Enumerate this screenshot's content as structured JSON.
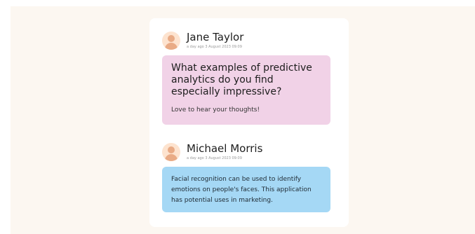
{
  "posts": [
    {
      "author": "Jane Taylor",
      "timestamp": "a day ago 3 August 2023 09:09",
      "question": "What examples of predictive analytics do you find especially impressive?",
      "note": "Love to hear your thoughts!",
      "bubble_color": "#f1d2e7"
    },
    {
      "author": "Michael Morris",
      "timestamp": "a day ago 3 August 2023 09:09",
      "message": "Facial recognition can be used to identify emotions on people's faces. This application has potential uses in marketing.",
      "bubble_color": "#a5d8f5"
    }
  ],
  "colors": {
    "page_background": "#fcf7f1",
    "card_background": "#ffffff",
    "avatar_background": "#fde3cf",
    "avatar_figure": "#e9ab86"
  },
  "icons": {
    "avatar": "user-avatar-icon"
  }
}
